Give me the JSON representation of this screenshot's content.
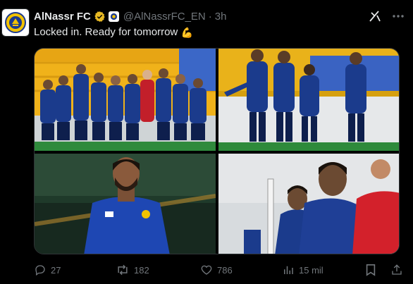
{
  "post": {
    "display_name": "AlNassr FC",
    "handle": "@AlNassrFC_EN",
    "separator": "·",
    "time": "3h",
    "text": "Locked in. Ready for tomorrow",
    "emoji": "💪"
  },
  "actions": {
    "replies": "27",
    "reposts": "182",
    "likes": "786",
    "views": "15 mil"
  },
  "colors": {
    "background": "#000000",
    "text": "#e7e9ea",
    "muted": "#71767b",
    "verified_gold": "#e8b923",
    "kit_blue": "#1c3a8f"
  }
}
